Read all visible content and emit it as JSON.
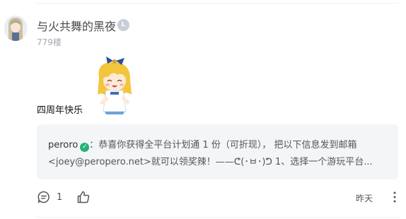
{
  "comment": {
    "username": "与火共舞的黑夜",
    "level_badge": "L",
    "floor": "779楼",
    "text": "四周年快乐",
    "sticker_icon": "anime-girl-sticker",
    "timestamp": "昨天",
    "comment_count": "1"
  },
  "quote": {
    "author": "peroro",
    "body_line1": "：恭喜你获得全平台计划通 1 份（可折现）， 把以下信息发到邮箱",
    "body_line2": "<joey@peropero.net>就可以领奖辣！——ᕦ(･ㅂ･)ᕤ 1、选择一个游玩平台..."
  },
  "colors": {
    "verified": "#24b37a",
    "quote_bg": "#f4f5f7",
    "meta_gray": "#a3a9b3"
  }
}
